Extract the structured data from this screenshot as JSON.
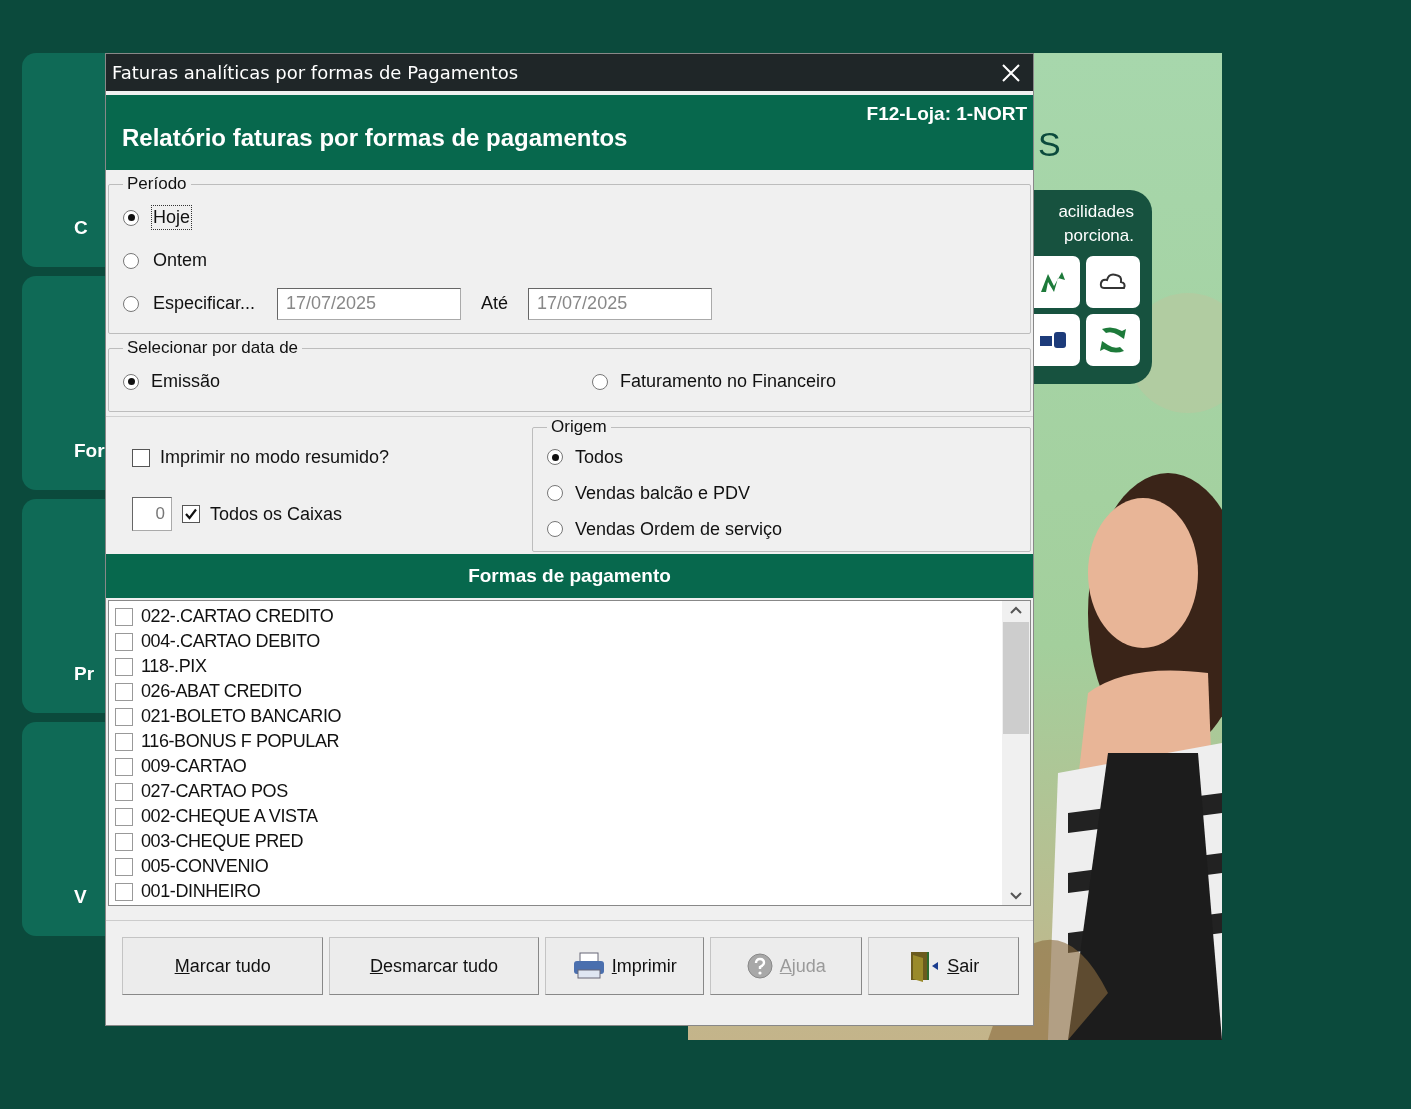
{
  "background": {
    "tiles": [
      {
        "label": "C"
      },
      {
        "label": "For"
      },
      {
        "label": "Pr"
      },
      {
        "label": "V"
      }
    ],
    "promo": {
      "logo": "S",
      "lines": [
        "acilidades",
        "porciona."
      ]
    }
  },
  "window": {
    "title": "Faturas analíticas por formas de Pagamentos"
  },
  "header": {
    "title": "Relatório faturas por formas de pagamentos",
    "store": "F12-Loja: 1-NORT"
  },
  "period": {
    "legend": "Período",
    "options": [
      {
        "label": "Hoje",
        "selected": true,
        "focused": true
      },
      {
        "label": "Ontem",
        "selected": false,
        "focused": false
      },
      {
        "label": "Especificar...",
        "selected": false,
        "focused": false
      }
    ],
    "from": {
      "value": "17/07/2025",
      "disabled": true
    },
    "to_label": "Até",
    "to": {
      "value": "17/07/2025",
      "disabled": true
    }
  },
  "date_basis": {
    "legend": "Selecionar por data de",
    "options": [
      {
        "label": "Emissão",
        "selected": true
      },
      {
        "label": "Faturamento no Financeiro",
        "selected": false
      }
    ]
  },
  "summary": {
    "label": "Imprimir no modo resumido?",
    "checked": false
  },
  "cashier": {
    "value": "0",
    "all": {
      "label": "Todos os Caixas",
      "checked": true
    }
  },
  "origin": {
    "legend": "Origem",
    "options": [
      {
        "label": "Todos",
        "selected": true
      },
      {
        "label": "Vendas balcão e PDV",
        "selected": false
      },
      {
        "label": "Vendas Ordem de serviço",
        "selected": false
      }
    ]
  },
  "payments": {
    "title": "Formas de pagamento",
    "items": [
      {
        "label": "022-.CARTAO CREDITO",
        "checked": false
      },
      {
        "label": "004-.CARTAO DEBITO",
        "checked": false
      },
      {
        "label": "118-.PIX",
        "checked": false
      },
      {
        "label": "026-ABAT CREDITO",
        "checked": false
      },
      {
        "label": "021-BOLETO BANCARIO",
        "checked": false
      },
      {
        "label": "116-BONUS F POPULAR",
        "checked": false
      },
      {
        "label": "009-CARTAO",
        "checked": false
      },
      {
        "label": "027-CARTAO POS",
        "checked": false
      },
      {
        "label": "002-CHEQUE A VISTA",
        "checked": false
      },
      {
        "label": "003-CHEQUE PRED",
        "checked": false
      },
      {
        "label": "005-CONVENIO",
        "checked": false
      },
      {
        "label": "001-DINHEIRO",
        "checked": false
      }
    ]
  },
  "buttons": [
    {
      "kind": "text",
      "mnemonic": "M",
      "rest": "arcar tudo",
      "disabled": false
    },
    {
      "kind": "text",
      "mnemonic": "D",
      "rest": "esmarcar tudo",
      "disabled": false
    },
    {
      "kind": "print",
      "mnemonic": "I",
      "rest": "mprimir",
      "disabled": false
    },
    {
      "kind": "help",
      "mnemonic": "A",
      "rest": "juda",
      "disabled": true
    },
    {
      "kind": "exit",
      "mnemonic": "S",
      "rest": "air",
      "disabled": false
    }
  ]
}
